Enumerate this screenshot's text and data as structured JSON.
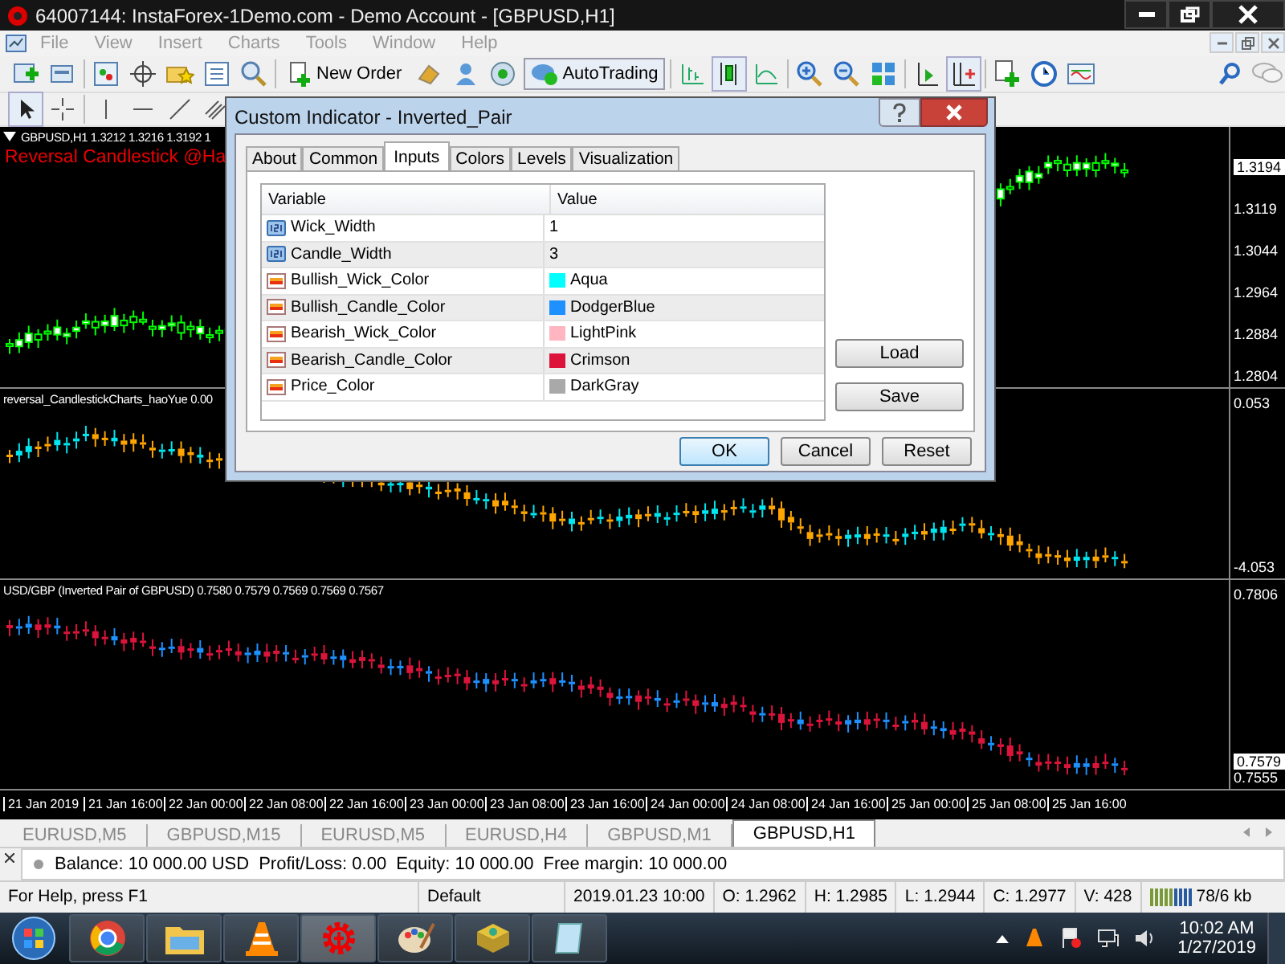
{
  "window": {
    "title": "64007144: InstaForex-1Demo.com - Demo Account - [GBPUSD,H1]"
  },
  "menu": [
    "File",
    "View",
    "Insert",
    "Charts",
    "Tools",
    "Window",
    "Help"
  ],
  "toolbar": {
    "buttons": [
      {
        "label": "New Order",
        "on": false
      },
      {
        "label": "AutoTrading",
        "on": true
      }
    ]
  },
  "charts": [
    {
      "header": "GBPUSD,H1  1.3212 1.3216 1.3192 1",
      "subtitle": "Reversal Candlestick @Ha",
      "prices": [
        {
          "text": "1.3194",
          "kind": "current"
        },
        {
          "text": "1.3119",
          "kind": "tick"
        },
        {
          "text": "1.3044",
          "kind": "tick"
        },
        {
          "text": "1.2964",
          "kind": "tick"
        },
        {
          "text": "1.2884",
          "kind": "tick"
        },
        {
          "text": "1.2804",
          "kind": "tick"
        }
      ]
    },
    {
      "header": "reversal_CandlestickCharts_haoYue 0.00",
      "prices": [
        {
          "text": "0.053",
          "kind": "tick"
        },
        {
          "text": "-4.053",
          "kind": "tick"
        }
      ]
    },
    {
      "header": "USD/GBP (Inverted Pair of GBPUSD) 0.7580 0.7579 0.7569 0.7569 0.7567",
      "prices": [
        {
          "text": "0.7806",
          "kind": "tick"
        },
        {
          "text": "0.7579",
          "kind": "current"
        },
        {
          "text": "0.7555",
          "kind": "tick"
        }
      ]
    }
  ],
  "time_axis": [
    "21 Jan 2019",
    "21 Jan 16:00",
    "22 Jan 00:00",
    "22 Jan 08:00",
    "22 Jan 16:00",
    "23 Jan 00:00",
    "23 Jan 08:00",
    "23 Jan 16:00",
    "24 Jan 00:00",
    "24 Jan 08:00",
    "24 Jan 16:00",
    "25 Jan 00:00",
    "25 Jan 08:00",
    "25 Jan 16:00"
  ],
  "chart_tabs": [
    {
      "label": "EURUSD,M5",
      "selected": false
    },
    {
      "label": "GBPUSD,M15",
      "selected": false
    },
    {
      "label": "EURUSD,M5",
      "selected": false
    },
    {
      "label": "EURUSD,H4",
      "selected": false
    },
    {
      "label": "GBPUSD,M1",
      "selected": false
    },
    {
      "label": "GBPUSD,H1",
      "selected": true
    }
  ],
  "terminal": [
    "Balance: 10 000.00 USD",
    "Profit/Loss: 0.00",
    "Equity: 10 000.00",
    "Free margin: 10 000.00"
  ],
  "status_bar": {
    "help": "For Help, press F1",
    "profile": "Default",
    "fields": [
      "2019.01.23 10:00",
      "O: 1.2962",
      "H: 1.2985",
      "L: 1.2944",
      "C: 1.2977",
      "V: 428"
    ],
    "traffic": "78/6 kb"
  },
  "dialog": {
    "title": "Custom Indicator - Inverted_Pair",
    "tabs": [
      {
        "label": "About",
        "selected": false
      },
      {
        "label": "Common",
        "selected": false
      },
      {
        "label": "Inputs",
        "selected": true
      },
      {
        "label": "Colors",
        "selected": false
      },
      {
        "label": "Levels",
        "selected": false
      },
      {
        "label": "Visualization",
        "selected": false
      }
    ],
    "columns": [
      "Variable",
      "Value"
    ],
    "rows": [
      {
        "variable": "Wick_Width",
        "value": "1",
        "kind": "number"
      },
      {
        "variable": "Candle_Width",
        "value": "3",
        "kind": "number"
      },
      {
        "variable": "Bullish_Wick_Color",
        "value": "Aqua",
        "kind": "color",
        "color": "#00ffff"
      },
      {
        "variable": "Bullish_Candle_Color",
        "value": "DodgerBlue",
        "kind": "color",
        "color": "#1e90ff"
      },
      {
        "variable": "Bearish_Wick_Color",
        "value": "LightPink",
        "kind": "color",
        "color": "#ffb6c1"
      },
      {
        "variable": "Bearish_Candle_Color",
        "value": "Crimson",
        "kind": "color",
        "color": "#dc143c"
      },
      {
        "variable": "Price_Color",
        "value": "DarkGray",
        "kind": "color",
        "color": "#a9a9a9"
      }
    ],
    "side_buttons": [
      "Load",
      "Save"
    ],
    "buttons": [
      {
        "label": "OK",
        "default": true
      },
      {
        "label": "Cancel",
        "default": false
      },
      {
        "label": "Reset",
        "default": false
      }
    ]
  },
  "clock": {
    "time": "10:02 AM",
    "date": "1/27/2019"
  }
}
